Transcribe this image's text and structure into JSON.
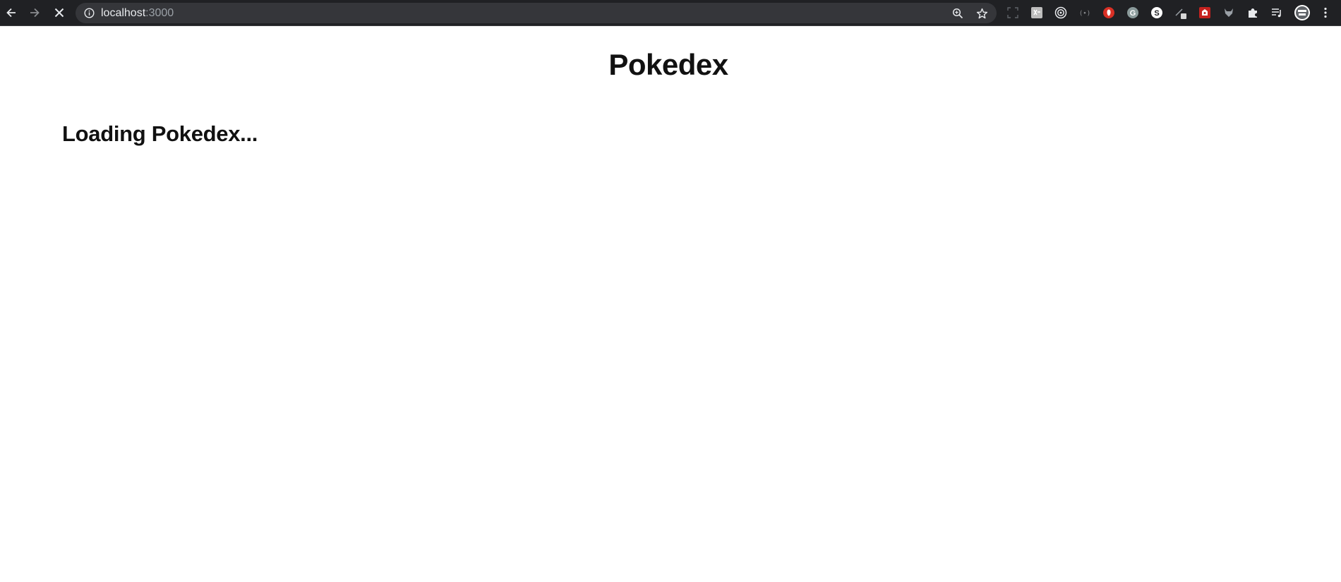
{
  "browser": {
    "url_host": "localhost",
    "url_port": ":3000",
    "accent": "#202124"
  },
  "extensions": [
    "screenshot-extension-icon",
    "translate-extension-icon",
    "target-extension-icon",
    "broadcast-extension-icon",
    "ublock-extension-icon",
    "grammarly-extension-icon",
    "s-extension-icon",
    "pen-extension-icon",
    "red-extension-icon",
    "fox-extension-icon",
    "puzzle-icon",
    "playlist-icon",
    "profile-avatar",
    "kebab-menu-icon"
  ],
  "page": {
    "title": "Pokedex",
    "loading_text": "Loading Pokedex..."
  }
}
